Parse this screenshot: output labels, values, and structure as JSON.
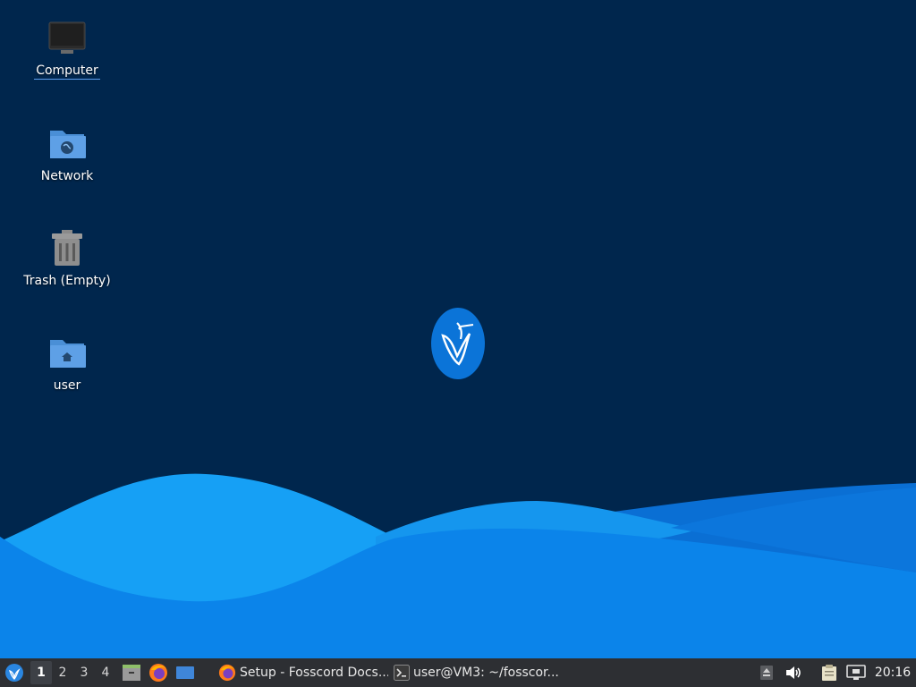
{
  "desktop": {
    "icons": [
      {
        "label": "Computer",
        "icon": "computer-icon"
      },
      {
        "label": "Network",
        "icon": "network-folder-icon"
      },
      {
        "label": "Trash (Empty)",
        "icon": "trash-icon"
      },
      {
        "label": "user",
        "icon": "home-folder-icon"
      }
    ],
    "background_color": "#00264d",
    "center_logo": "hummingbird-logo-icon"
  },
  "panel": {
    "menu_icon": "whisker-menu-icon",
    "workspaces": [
      "1",
      "2",
      "3",
      "4"
    ],
    "active_workspace": "1",
    "launchers": [
      "file-manager-icon",
      "firefox-icon",
      "show-desktop-icon"
    ],
    "tasks": [
      {
        "label": "Setup - Fosscord Docs...",
        "icon": "firefox-icon"
      },
      {
        "label": "user@VM3: ~/fosscor...",
        "icon": "terminal-icon"
      }
    ],
    "tray": [
      "eject-icon",
      "volume-icon",
      "clipboard-icon",
      "network-wired-icon"
    ],
    "clock": "20:16"
  },
  "colors": {
    "panel": "#2d2f33",
    "wave_light": "#1a9bf0",
    "wave_mid": "#0a7de6",
    "wave_dark": "#0964c8"
  }
}
